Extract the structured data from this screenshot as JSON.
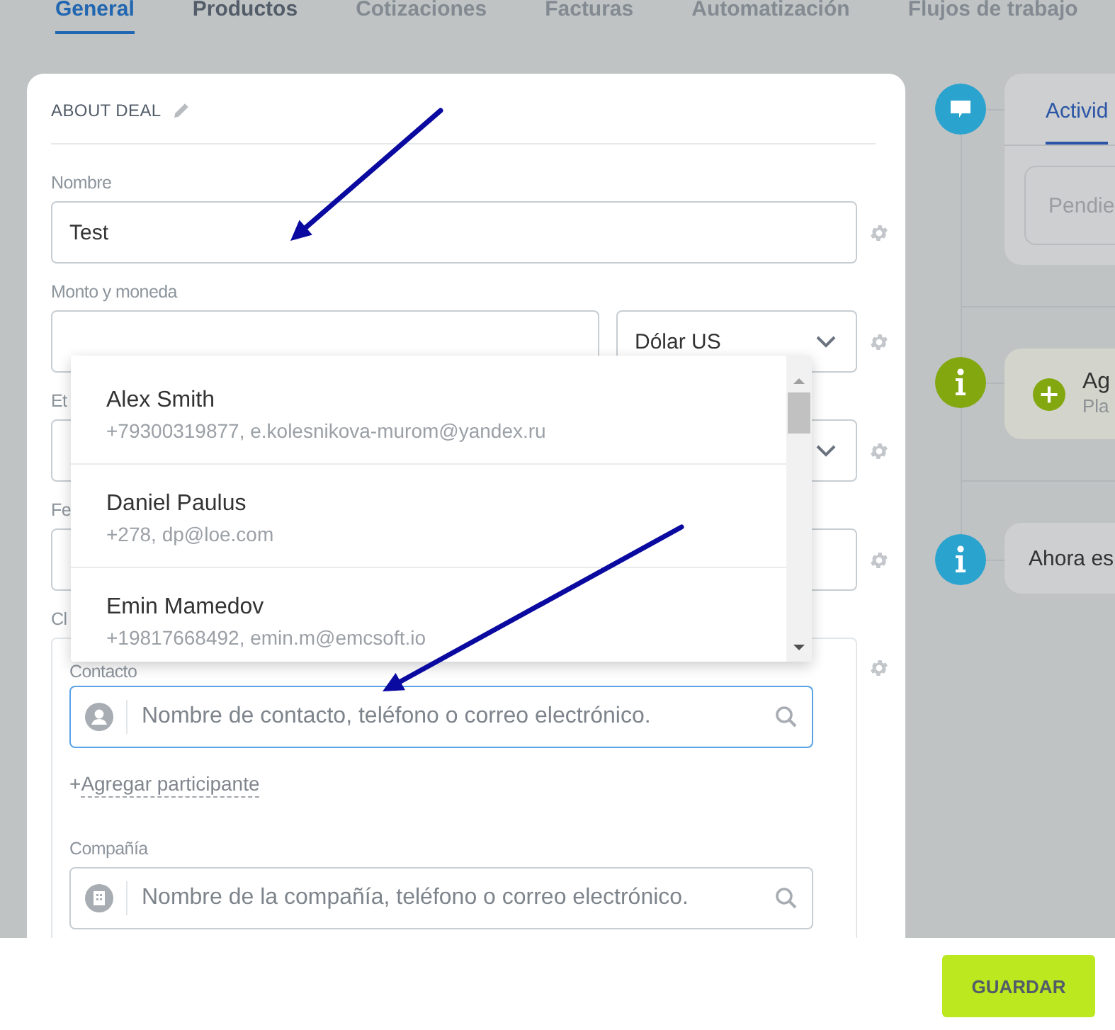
{
  "tabs": [
    {
      "label": "General",
      "selected": true,
      "disabled": false
    },
    {
      "label": "Productos",
      "selected": false,
      "disabled": false
    },
    {
      "label": "Cotizaciones",
      "selected": false,
      "disabled": true
    },
    {
      "label": "Facturas",
      "selected": false,
      "disabled": true
    },
    {
      "label": "Automatización",
      "selected": false,
      "disabled": true
    },
    {
      "label": "Flujos de trabajo",
      "selected": false,
      "disabled": true
    }
  ],
  "deal_card": {
    "title": "ABOUT DEAL",
    "fields": [
      {
        "kind": "text",
        "label": "Nombre",
        "value": "Test"
      },
      {
        "kind": "amount",
        "label": "Monto y moneda",
        "currency": "Dólar US"
      },
      {
        "kind": "select",
        "label": "Et"
      },
      {
        "kind": "text",
        "label": "Fe"
      },
      {
        "kind": "client",
        "label": "Cl",
        "contact_label": "Contacto",
        "contact_placeholder": "Nombre de contacto, teléfono o correo electrónico.",
        "add_sign": "+",
        "add_link": "Agregar participante",
        "company_label": "Compañía",
        "company_placeholder": "Nombre de la compañía, teléfono o correo electrónico."
      }
    ]
  },
  "contact_dropdown": {
    "items": [
      {
        "name": "Alex Smith",
        "details": "+79300319877, e.kolesnikova-murom@yandex.ru"
      },
      {
        "name": "Daniel Paulus",
        "details": "+278, dp@loe.com"
      },
      {
        "name": "Emin Mamedov",
        "details": "+19817668492, emin.m@emcsoft.io"
      }
    ]
  },
  "timeline": [
    {
      "kind": "chat",
      "color": "#2ba3cf",
      "tab": "Activid",
      "placeholder": "Pendie"
    },
    {
      "kind": "add",
      "color": "#83a80f",
      "title": "Ag",
      "subtitle": "Pla"
    },
    {
      "kind": "note",
      "color": "#2ba3cf",
      "text": "Ahora es"
    }
  ],
  "annotations": [
    {
      "kind": "arrow"
    },
    {
      "kind": "arrow"
    }
  ],
  "footer": {
    "save": "GUARDAR"
  }
}
